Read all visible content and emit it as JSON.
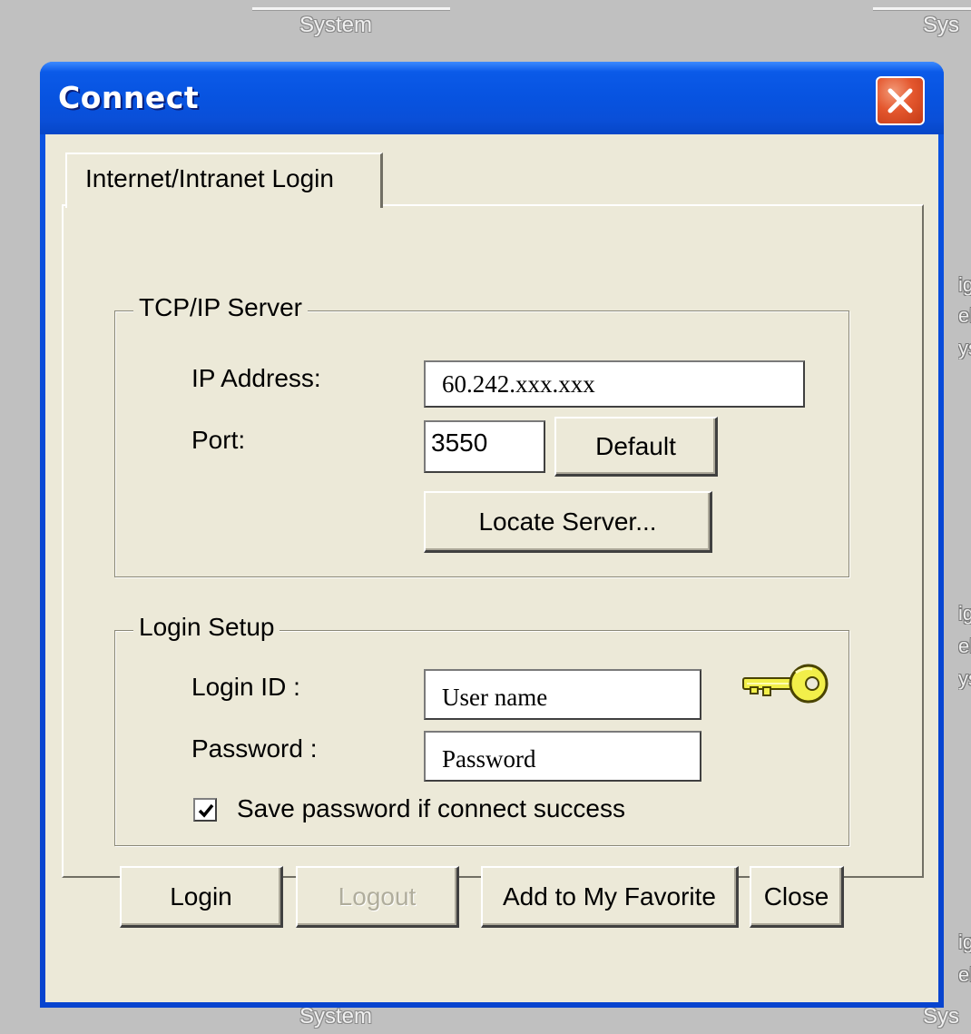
{
  "background": {
    "top_label": "System",
    "top_right_label": "Sys",
    "bottom_label": "System",
    "bottom_right_label": "Sys",
    "side_fragments": [
      "ig",
      "el",
      "ys"
    ]
  },
  "window": {
    "title": "Connect",
    "close_icon": "close-icon"
  },
  "tab": {
    "label": "Internet/Intranet Login"
  },
  "tcp_group": {
    "legend": "TCP/IP Server",
    "ip_label": "IP Address:",
    "ip_value": "60.242.xxx.xxx",
    "port_label": "Port:",
    "port_value": "3550",
    "default_button": "Default",
    "locate_button": "Locate Server..."
  },
  "login_group": {
    "legend": "Login Setup",
    "login_id_label": "Login ID :",
    "login_id_value": "User name",
    "password_label": "Password :",
    "password_value": "Password",
    "save_password_label": "Save password if connect success",
    "save_password_checked": true,
    "key_icon": "key-icon"
  },
  "actions": {
    "login": "Login",
    "logout": "Logout",
    "add_favorite": "Add to My Favorite",
    "close": "Close"
  },
  "colors": {
    "titlebar_blue": "#0753e0",
    "dialog_face": "#ece9d8",
    "close_red": "#e4572e",
    "key_yellow": "#f2ef4a"
  }
}
